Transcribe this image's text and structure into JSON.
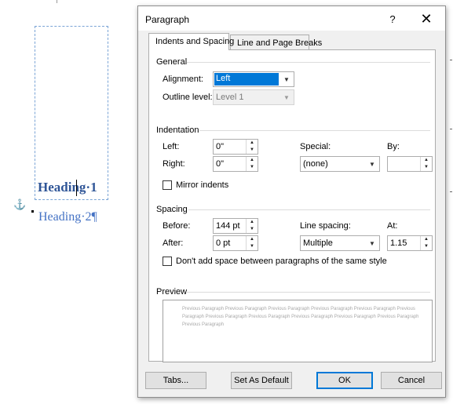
{
  "document": {
    "heading1": "Heading·1",
    "heading2": "Heading·2¶",
    "anchor_symbol": "⚓"
  },
  "dialog": {
    "title": "Paragraph",
    "help_label": "?",
    "close_label": "✕",
    "tabs": [
      {
        "label": "Indents and Spacing",
        "active": true
      },
      {
        "label": "Line and Page Breaks",
        "active": false
      }
    ],
    "general": {
      "title": "General",
      "alignment_label": "Alignment:",
      "alignment_value": "Left",
      "outline_label": "Outline level:",
      "outline_value": "Level 1"
    },
    "indentation": {
      "title": "Indentation",
      "left_label": "Left:",
      "left_value": "0\"",
      "right_label": "Right:",
      "right_value": "0\"",
      "special_label": "Special:",
      "special_value": "(none)",
      "by_label": "By:",
      "by_value": "",
      "mirror_label": "Mirror indents",
      "mirror_checked": false
    },
    "spacing": {
      "title": "Spacing",
      "before_label": "Before:",
      "before_value": "144 pt",
      "after_label": "After:",
      "after_value": "0 pt",
      "line_spacing_label": "Line spacing:",
      "line_spacing_value": "Multiple",
      "at_label": "At:",
      "at_value": "1.15",
      "dont_add_label": "Don't add space between paragraphs of the same style",
      "dont_add_checked": false
    },
    "preview": {
      "title": "Preview",
      "text": "Previous Paragraph Previous Paragraph Previous Paragraph Previous Paragraph Previous Paragraph Previous Paragraph Previous Paragraph Previous Paragraph Previous Paragraph Previous Paragraph Previous Paragraph Previous Paragraph"
    },
    "buttons": {
      "tabs": "Tabs...",
      "set_default": "Set As Default",
      "ok": "OK",
      "cancel": "Cancel"
    }
  },
  "colors": {
    "heading1": "#2f5597",
    "heading2": "#4472c4",
    "selection": "#0078d7",
    "dialog_bg": "#f0f0f0"
  }
}
